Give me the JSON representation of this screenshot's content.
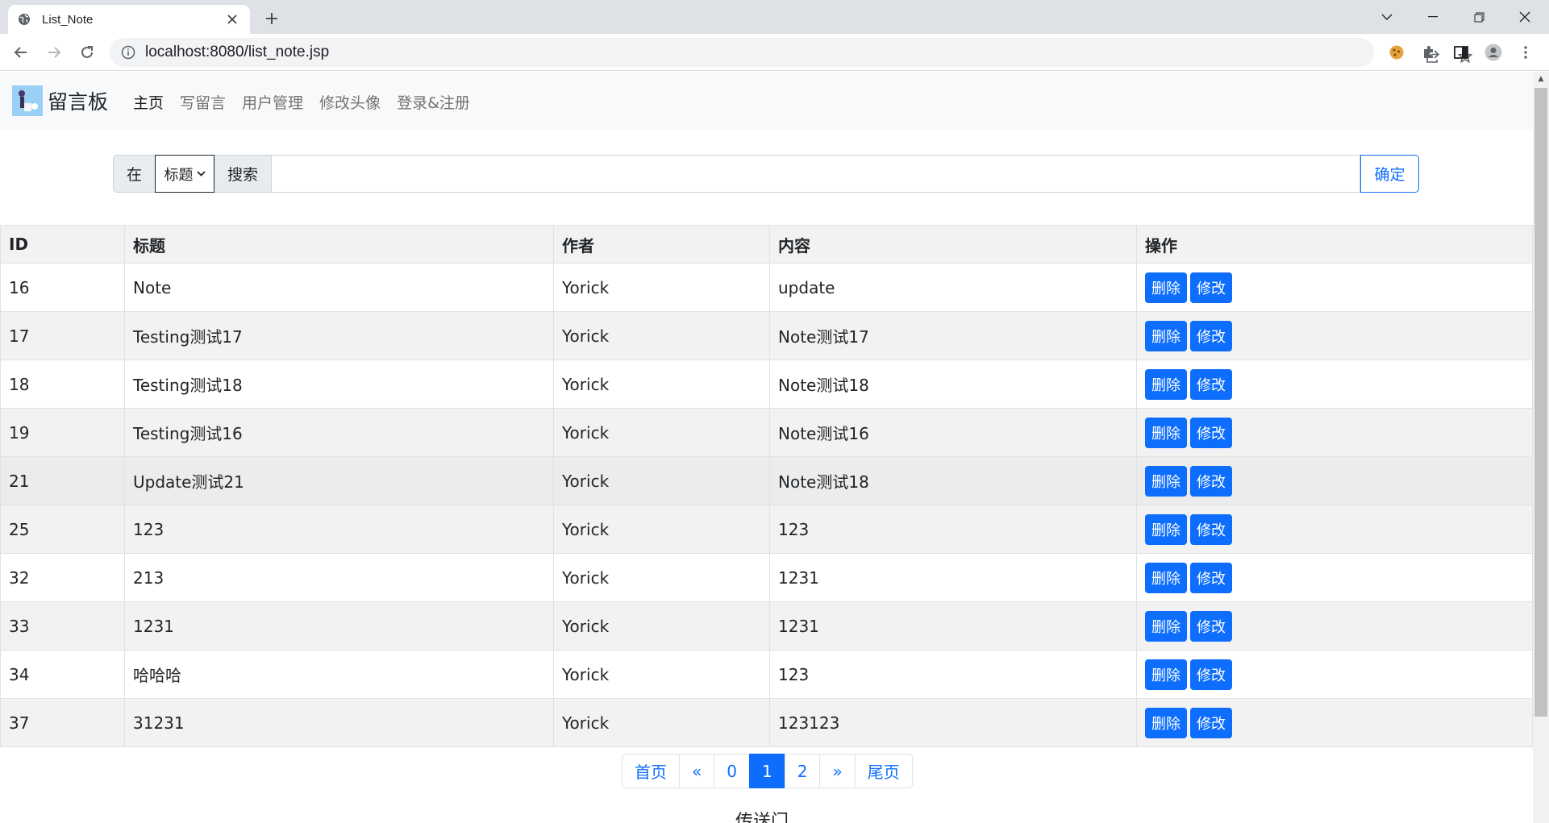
{
  "browser": {
    "tab_title": "List_Note",
    "url": "localhost:8080/list_note.jsp"
  },
  "nav": {
    "brand": "留言板",
    "links": [
      "主页",
      "写留言",
      "用户管理",
      "修改头像",
      "登录&注册"
    ],
    "active_index": 0
  },
  "search": {
    "prefix": "在",
    "field_selected": "标题",
    "search_label": "搜索",
    "input_value": "",
    "submit_label": "确定"
  },
  "table": {
    "headers": [
      "ID",
      "标题",
      "作者",
      "内容",
      "操作"
    ],
    "delete_label": "删除",
    "edit_label": "修改",
    "rows": [
      {
        "id": "16",
        "title": "Note",
        "author": "Yorick",
        "content": "update"
      },
      {
        "id": "17",
        "title": "Testing测试17",
        "author": "Yorick",
        "content": "Note测试17"
      },
      {
        "id": "18",
        "title": "Testing测试18",
        "author": "Yorick",
        "content": "Note测试18"
      },
      {
        "id": "19",
        "title": "Testing测试16",
        "author": "Yorick",
        "content": "Note测试16"
      },
      {
        "id": "21",
        "title": "Update测试21",
        "author": "Yorick",
        "content": "Note测试18"
      },
      {
        "id": "25",
        "title": "123",
        "author": "Yorick",
        "content": "123"
      },
      {
        "id": "32",
        "title": "213",
        "author": "Yorick",
        "content": "1231"
      },
      {
        "id": "33",
        "title": "1231",
        "author": "Yorick",
        "content": "1231"
      },
      {
        "id": "34",
        "title": "哈哈哈",
        "author": "Yorick",
        "content": "123"
      },
      {
        "id": "37",
        "title": "31231",
        "author": "Yorick",
        "content": "123123"
      }
    ]
  },
  "pagination": {
    "items": [
      "首页",
      "«",
      "0",
      "1",
      "2",
      "»",
      "尾页"
    ],
    "active_index": 3
  },
  "footer": {
    "link_text": "传送门"
  },
  "colors": {
    "primary": "#0d6efd",
    "navbar_bg": "#f8f9fa",
    "stripe": "#f2f2f2"
  }
}
